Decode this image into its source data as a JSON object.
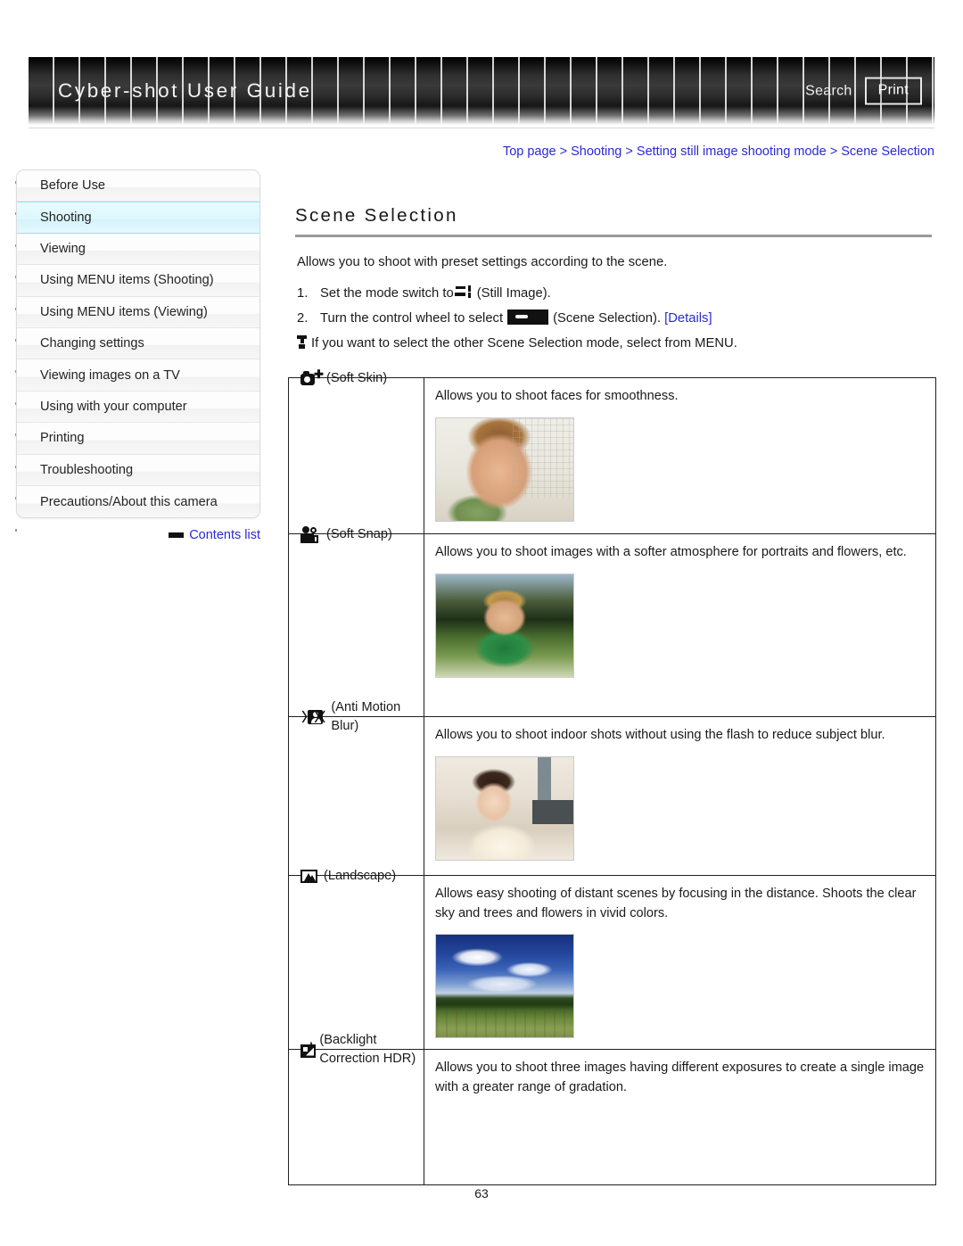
{
  "header": {
    "title": "Cyber-shot User Guide",
    "search_label": "Search",
    "print_label": "Print"
  },
  "breadcrumb": {
    "text": "Top page > Shooting > Setting still image shooting mode > Scene Selection",
    "items": [
      "Top page",
      "Shooting",
      "Setting still image shooting mode",
      "Scene Selection"
    ],
    "separator": ">",
    "link_color": "#2a2ad0"
  },
  "sidebar": {
    "items": [
      {
        "label": "Before Use",
        "active": false
      },
      {
        "label": "Shooting",
        "active": true
      },
      {
        "label": "Viewing",
        "active": false
      },
      {
        "label": "Using MENU items (Shooting)",
        "active": false
      },
      {
        "label": "Using MENU items (Viewing)",
        "active": false
      },
      {
        "label": "Changing settings",
        "active": false
      },
      {
        "label": "Viewing images on a TV",
        "active": false
      },
      {
        "label": "Using with your computer",
        "active": false
      },
      {
        "label": "Printing",
        "active": false
      },
      {
        "label": "Troubleshooting",
        "active": false
      },
      {
        "label": "Precautions/About this camera",
        "active": false
      }
    ],
    "active_bg": "#ddf7fd",
    "contents_link": "Contents list"
  },
  "main": {
    "title": "Scene Selection",
    "intro": "Allows you to shoot with preset settings according to the scene.",
    "steps": [
      {
        "number": "1.",
        "before_icon": "Set the mode switch to",
        "icon": "still-image-icon",
        "after_icon": "(Still Image)."
      },
      {
        "number": "2.",
        "before_icon": "Turn the control wheel to select",
        "icon": "scene-selection-wheel-icon",
        "after_icon": "(Scene Selection).",
        "link": "[Details]"
      }
    ],
    "note": {
      "icon": "tip-icon",
      "text": "If you want to select the other Scene Selection mode, select from MENU."
    }
  },
  "table": {
    "rows": [
      {
        "icon": "soft-skin-icon",
        "mode": "(Soft Skin)",
        "description": "Allows you to shoot faces for smoothness.",
        "thumbnail": "child-face-photo",
        "has_thumbnail": true
      },
      {
        "icon": "soft-snap-icon",
        "mode": "(Soft Snap)",
        "description": "Allows you to shoot images with a softer atmosphere for portraits and flowers, etc.",
        "thumbnail": "child-in-field-photo",
        "has_thumbnail": true
      },
      {
        "icon": "anti-motion-blur-icon",
        "mode": "(Anti Motion Blur)",
        "description": "Allows you to shoot indoor shots without using the flash to reduce subject blur.",
        "thumbnail": "child-indoor-photo",
        "has_thumbnail": true
      },
      {
        "icon": "landscape-icon",
        "mode": "(Landscape)",
        "description": "Allows easy shooting of distant scenes by focusing in the distance. Shoots the clear sky and trees and flowers in vivid colors.",
        "thumbnail": "landscape-sky-photo",
        "has_thumbnail": true
      },
      {
        "icon": "backlight-correction-hdr-icon",
        "mode": "(Backlight Correction HDR)",
        "description": "Allows you to shoot three images having different exposures to create a single image with a greater range of gradation.",
        "thumbnail": "",
        "has_thumbnail": false
      }
    ]
  },
  "footer": {
    "page_number": "63"
  }
}
